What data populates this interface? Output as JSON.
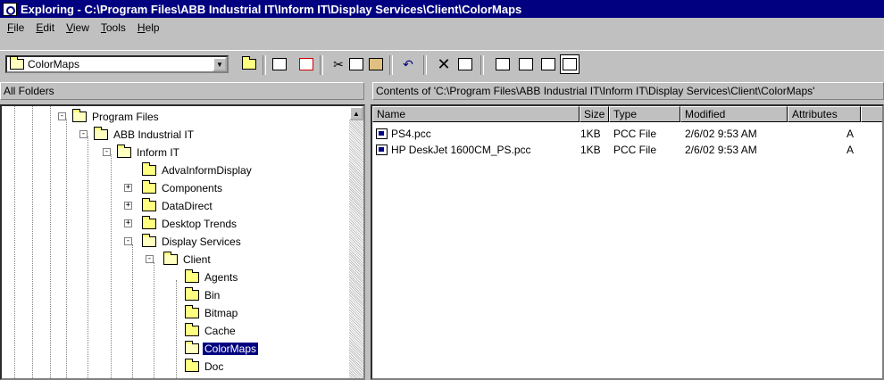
{
  "window": {
    "title": "Exploring - C:\\Program Files\\ABB Industrial IT\\Inform IT\\Display Services\\Client\\ColorMaps"
  },
  "menu": [
    {
      "accel": "F",
      "rest": "ile"
    },
    {
      "accel": "E",
      "rest": "dit"
    },
    {
      "accel": "V",
      "rest": "iew"
    },
    {
      "accel": "T",
      "rest": "ools"
    },
    {
      "accel": "H",
      "rest": "elp"
    }
  ],
  "address": {
    "value": "ColorMaps"
  },
  "headers": {
    "left": "All Folders",
    "right": "Contents of 'C:\\Program Files\\ABB Industrial IT\\Inform IT\\Display Services\\Client\\ColorMaps'"
  },
  "tree": [
    {
      "label": "Program Files"
    },
    {
      "label": "ABB Industrial IT"
    },
    {
      "label": "Inform IT"
    },
    {
      "label": "AdvaInformDisplay"
    },
    {
      "label": "Components"
    },
    {
      "label": "DataDirect"
    },
    {
      "label": "Desktop Trends"
    },
    {
      "label": "Display Services"
    },
    {
      "label": "Client"
    },
    {
      "label": "Agents"
    },
    {
      "label": "Bin"
    },
    {
      "label": "Bitmap"
    },
    {
      "label": "Cache"
    },
    {
      "label": "ColorMaps"
    },
    {
      "label": "Doc"
    }
  ],
  "columns": [
    "Name",
    "Size",
    "Type",
    "Modified",
    "Attributes"
  ],
  "files": [
    {
      "name": "PS4.pcc",
      "size": "1KB",
      "type": "PCC File",
      "modified": "2/6/02 9:53 AM",
      "attr": "A"
    },
    {
      "name": "HP DeskJet 1600CM_PS.pcc",
      "size": "1KB",
      "type": "PCC File",
      "modified": "2/6/02 9:53 AM",
      "attr": "A"
    }
  ]
}
